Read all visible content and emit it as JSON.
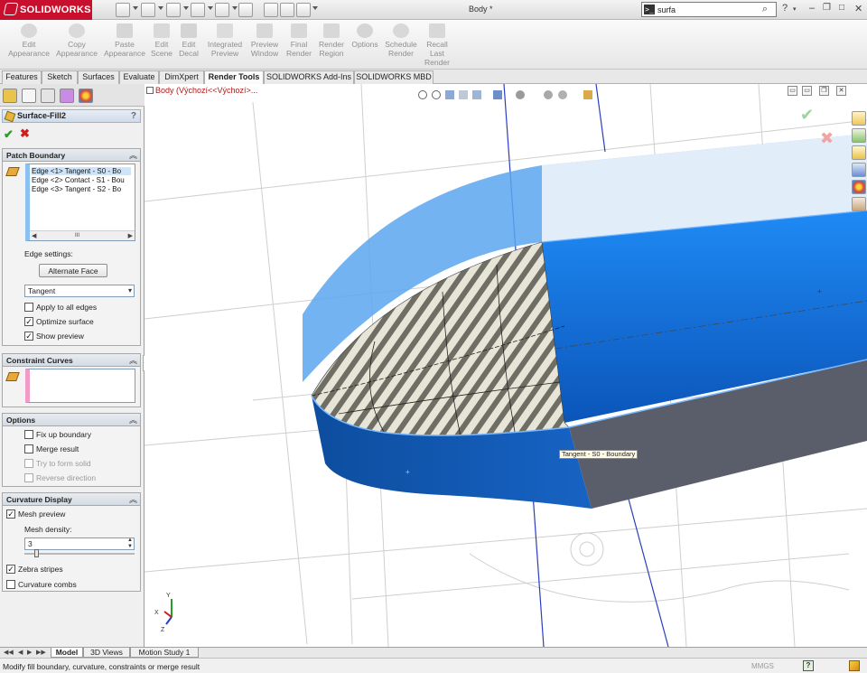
{
  "app": {
    "brand": "SOLIDWORKS",
    "document_title": "Body *"
  },
  "search": {
    "value": "surfa",
    "prompt_glyph": ">_"
  },
  "ribbon": {
    "buttons": [
      {
        "line1": "Edit",
        "line2": "Appearance",
        "line3": "",
        "icon": "edit-appearance-icon"
      },
      {
        "line1": "Copy",
        "line2": "Appearance",
        "line3": "",
        "icon": "copy-appearance-icon"
      },
      {
        "line1": "Paste",
        "line2": "Appearance",
        "line3": "",
        "icon": "paste-appearance-icon"
      },
      {
        "line1": "Edit",
        "line2": "Scene",
        "line3": "",
        "icon": "edit-scene-icon"
      },
      {
        "line1": "Edit",
        "line2": "Decal",
        "line3": "",
        "icon": "edit-decal-icon"
      },
      {
        "line1": "Integrated",
        "line2": "Preview",
        "line3": "",
        "icon": "integrated-preview-icon"
      },
      {
        "line1": "Preview",
        "line2": "Window",
        "line3": "",
        "icon": "preview-window-icon"
      },
      {
        "line1": "Final",
        "line2": "Render",
        "line3": "",
        "icon": "final-render-icon"
      },
      {
        "line1": "Render",
        "line2": "Region",
        "line3": "",
        "icon": "render-region-icon"
      },
      {
        "line1": "Options",
        "line2": "",
        "line3": "",
        "icon": "options-icon"
      },
      {
        "line1": "Schedule",
        "line2": "Render",
        "line3": "",
        "icon": "schedule-render-icon"
      },
      {
        "line1": "Recall",
        "line2": "Last",
        "line3": "Render",
        "icon": "recall-last-render-icon"
      }
    ]
  },
  "tabs": [
    "Features",
    "Sketch",
    "Surfaces",
    "Evaluate",
    "DimXpert",
    "Render Tools",
    "SOLIDWORKS Add-Ins",
    "SOLIDWORKS MBD"
  ],
  "active_tab": "Render Tools",
  "property_manager": {
    "title": "Surface-Fill2",
    "help_label": "?",
    "ok_glyph": "✔",
    "cancel_glyph": "✖",
    "patch_boundary": {
      "heading": "Patch Boundary",
      "collapse_glyph": "︽",
      "edges": [
        "Edge <1> Tangent - S0 - Bo",
        "Edge <2> Contact - S1 - Bou",
        "Edge <3> Tangent - S2 - Bo"
      ],
      "scroll_thumb": "III",
      "edge_settings_label": "Edge settings:",
      "alternate_face_label": "Alternate Face",
      "condition_value": "Tangent",
      "apply_all_edges": {
        "label": "Apply to all edges",
        "checked": false
      },
      "optimize_surface": {
        "label": "Optimize surface",
        "checked": true
      },
      "show_preview": {
        "label": "Show preview",
        "checked": true
      }
    },
    "constraint_curves": {
      "heading": "Constraint Curves"
    },
    "options": {
      "heading": "Options",
      "fix_up_boundary": {
        "label": "Fix up boundary",
        "checked": false
      },
      "merge_result": {
        "label": "Merge result",
        "checked": false
      },
      "try_to_form_solid": {
        "label": "Try to form solid",
        "checked": false,
        "disabled": true
      },
      "reverse_direction": {
        "label": "Reverse direction",
        "checked": false,
        "disabled": true
      }
    },
    "curvature_display": {
      "heading": "Curvature Display",
      "mesh_preview": {
        "label": "Mesh preview",
        "checked": true
      },
      "mesh_density_label": "Mesh density:",
      "mesh_density_value": "3",
      "zebra_stripes": {
        "label": "Zebra stripes",
        "checked": true
      },
      "curvature_combs": {
        "label": "Curvature combs",
        "checked": false
      }
    }
  },
  "viewport": {
    "breadcrumb": "Body  (Výchozí<<Výchozí>...",
    "tooltip": "Tangent - S0 - Boundary",
    "triad": {
      "x": "X",
      "y": "Y",
      "z": "Z"
    }
  },
  "bottom_tabs": [
    "Model",
    "3D Views",
    "Motion Study 1"
  ],
  "active_bottom_tab": "Model",
  "status": {
    "message": "Modify fill boundary, curvature, constraints or merge result",
    "units": "MMGS",
    "help_glyph": "?"
  },
  "colors": {
    "brand_red": "#c8102e",
    "surface_blue": "#1d6fd1",
    "ok_green": "#2a9a2a",
    "cancel_red": "#cc1f1f"
  }
}
